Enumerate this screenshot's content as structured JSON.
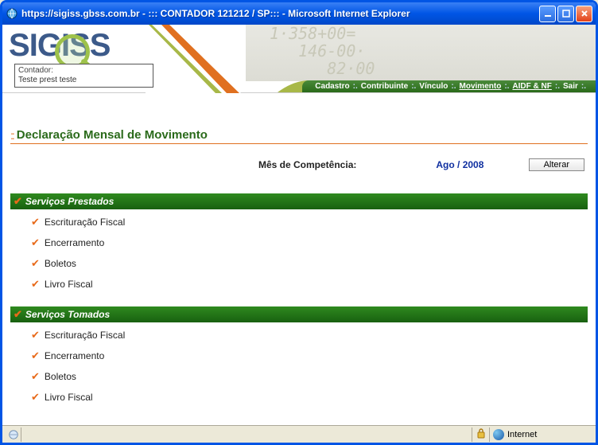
{
  "window": {
    "title": "https://sigiss.gbss.com.br - ::: CONTADOR 121212 / SP::: - Microsoft Internet Explorer"
  },
  "logo": {
    "text": "SIGISS"
  },
  "nav": {
    "items": [
      {
        "label": "Cadastro",
        "hl": false
      },
      {
        "label": "Contribuinte",
        "hl": false
      },
      {
        "label": "Vínculo",
        "hl": false
      },
      {
        "label": "Movimento",
        "hl": true
      },
      {
        "label": "AIDF & NF",
        "hl": true
      },
      {
        "label": "Sair",
        "hl": false
      }
    ]
  },
  "infobox": {
    "line1": "Contador:",
    "line2": "Teste prest teste"
  },
  "page": {
    "title": "Declaração Mensal de Movimento",
    "competencia_label": "Mês de Competência:",
    "competencia_value": "Ago / 2008",
    "alterar_label": "Alterar"
  },
  "sections": [
    {
      "title": "Serviços Prestados",
      "items": [
        "Escrituração Fiscal",
        "Encerramento",
        "Boletos",
        "Livro Fiscal"
      ]
    },
    {
      "title": "Serviços Tomados",
      "items": [
        "Escrituração Fiscal",
        "Encerramento",
        "Boletos",
        "Livro Fiscal"
      ]
    }
  ],
  "statusbar": {
    "zone": "Internet"
  }
}
